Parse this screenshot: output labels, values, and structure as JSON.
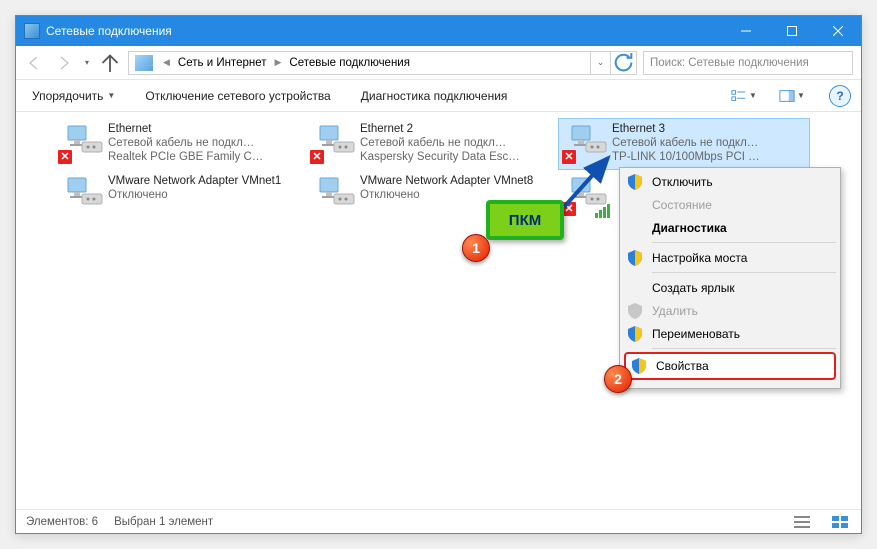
{
  "window": {
    "title": "Сетевые подключения"
  },
  "breadcrumb": {
    "item1": "Сеть и Интернет",
    "item2": "Сетевые подключения"
  },
  "search": {
    "placeholder": "Поиск: Сетевые подключения"
  },
  "commandbar": {
    "organize": "Упорядочить",
    "disable": "Отключение сетевого устройства",
    "diagnose": "Диагностика подключения"
  },
  "adapters": [
    {
      "name": "Ethernet",
      "line2": "Сетевой кабель не подкл…",
      "line3": "Realtek PCIe GBE Family C…",
      "redx": true
    },
    {
      "name": "Ethernet 2",
      "line2": "Сетевой кабель не подкл…",
      "line3": "Kaspersky Security Data Esc…",
      "redx": true
    },
    {
      "name": "Ethernet 3",
      "line2": "Сетевой кабель не подкл…",
      "line3": "TP-LINK 10/100Mbps PCI …",
      "redx": true,
      "selected": true
    },
    {
      "name": "VMware Network Adapter VMnet1",
      "line2": "Отключено",
      "line3": "",
      "redx": false
    },
    {
      "name": "VMware Network Adapter VMnet8",
      "line2": "Отключено",
      "line3": "",
      "redx": false
    },
    {
      "name": "",
      "line2": "",
      "line3": "",
      "redx": true,
      "bars": true,
      "iconOnly": true
    }
  ],
  "context_menu": {
    "disable": "Отключить",
    "status": "Состояние",
    "diagnose": "Диагностика",
    "bridge": "Настройка моста",
    "shortcut": "Создать ярлык",
    "delete": "Удалить",
    "rename": "Переименовать",
    "properties": "Свойства"
  },
  "annotation": {
    "pkm": "ПКМ",
    "one": "1",
    "two": "2"
  },
  "statusbar": {
    "count": "Элементов: 6",
    "selected": "Выбран 1 элемент"
  }
}
